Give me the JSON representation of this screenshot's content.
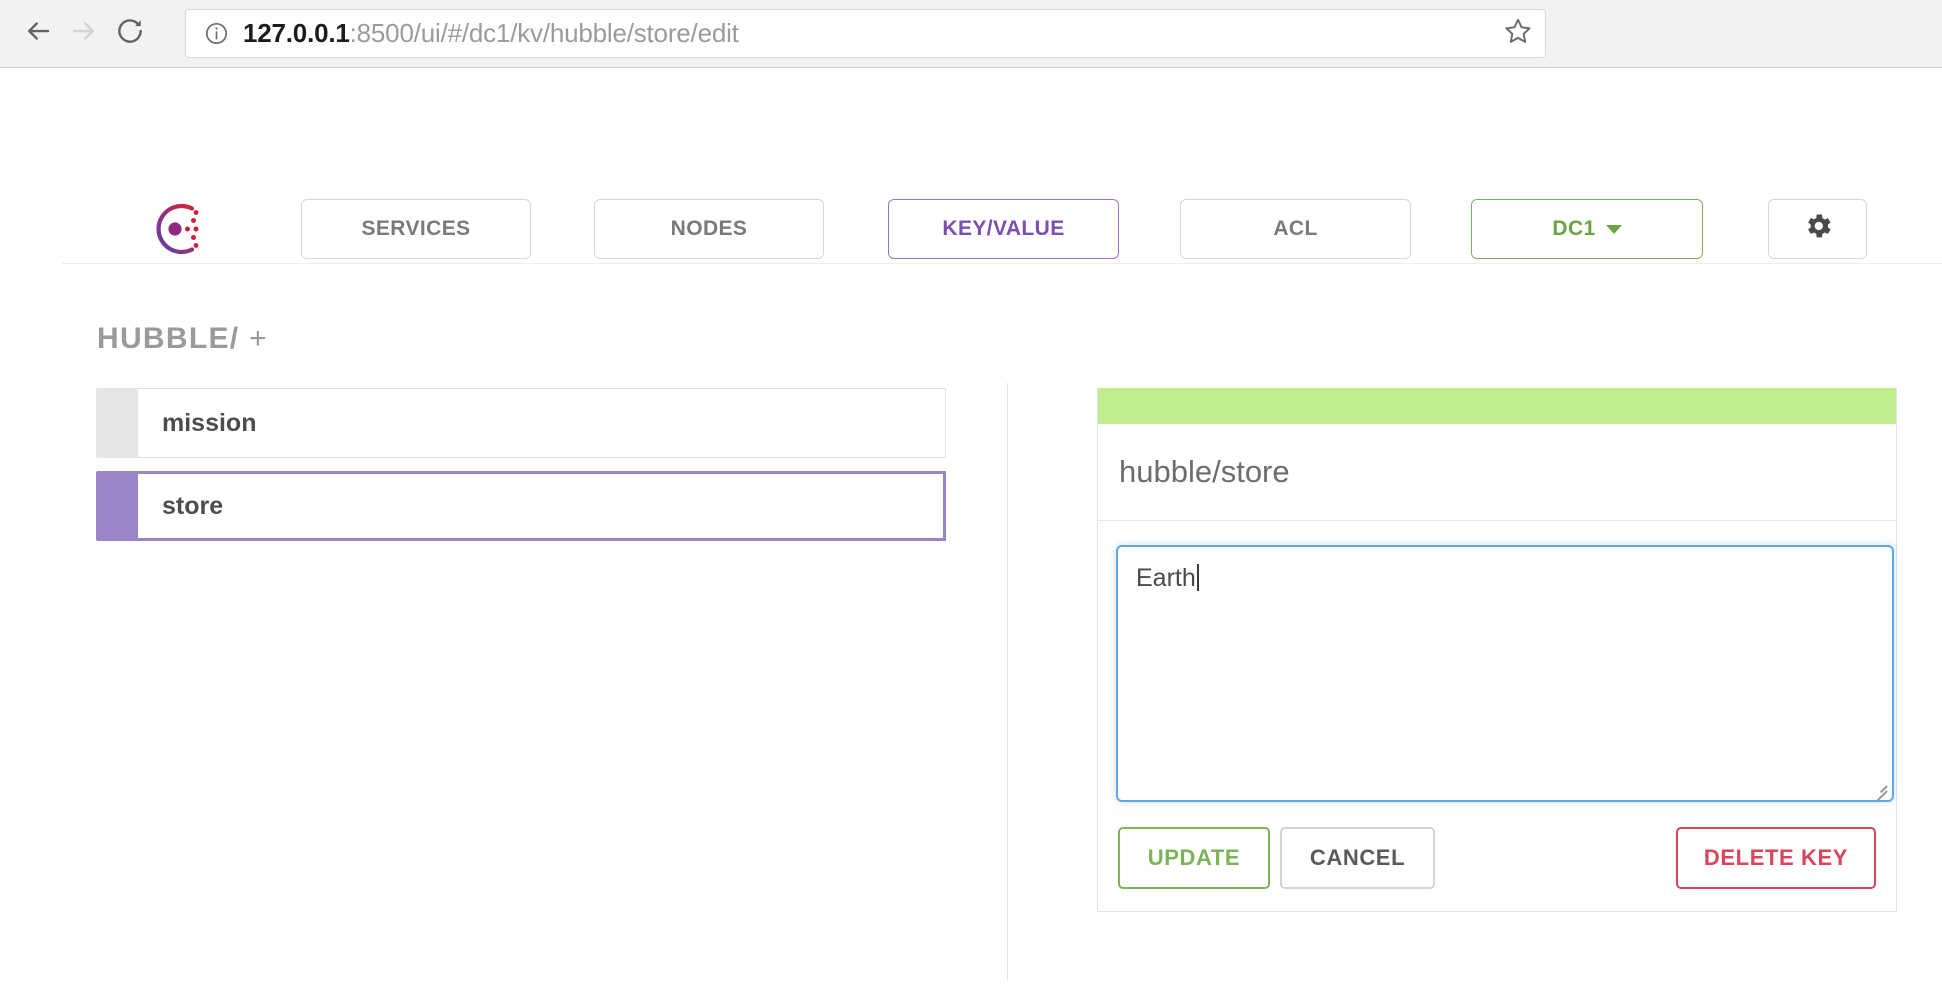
{
  "browser": {
    "back_icon": "back-arrow-icon",
    "forward_icon": "forward-arrow-icon",
    "reload_icon": "reload-icon",
    "info_icon": "info-circle-icon",
    "bookmark_icon": "star-outline-icon",
    "url_host": "127.0.0.1",
    "url_rest": ":8500/ui/#/dc1/kv/hubble/store/edit",
    "url_full": "127.0.0.1:8500/ui/#/dc1/kv/hubble/store/edit"
  },
  "header": {
    "logo_name": "consul-logo",
    "nav": [
      {
        "label": "SERVICES",
        "active": false
      },
      {
        "label": "NODES",
        "active": false
      },
      {
        "label": "KEY/VALUE",
        "active": true
      },
      {
        "label": "ACL",
        "active": false
      }
    ],
    "datacenter": {
      "label": "DC1",
      "caret_icon": "chevron-down-icon"
    },
    "settings_icon": "gear-icon"
  },
  "main": {
    "breadcrumb_path": "HUBBLE/",
    "breadcrumb_add": "+",
    "keys": [
      {
        "label": "mission",
        "selected": false
      },
      {
        "label": "store",
        "selected": true
      }
    ]
  },
  "detail": {
    "key_path": "hubble/store",
    "value": "Earth",
    "value_placeholder": "Value",
    "buttons": {
      "update": "UPDATE",
      "cancel": "CANCEL",
      "delete": "DELETE KEY"
    },
    "resize_handle_icon": "resize-grip-icon"
  },
  "colors": {
    "accent_purple": "#9b84c8",
    "kv_active_purple": "#7a4fb0",
    "accent_green": "#7bb457",
    "banner_green": "#c0ee8d",
    "danger_red": "#d9455a",
    "focus_blue": "#5fa8e8",
    "text_gray": "#7a7a7a"
  }
}
